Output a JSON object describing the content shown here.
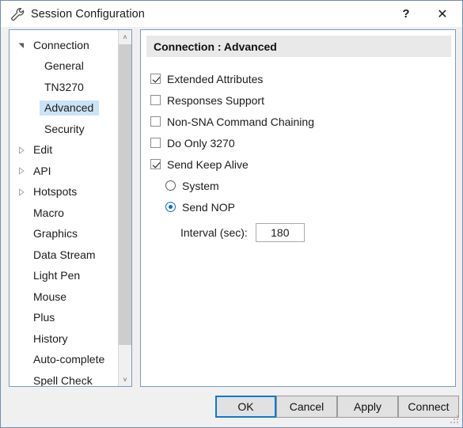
{
  "window": {
    "title": "Session Configuration",
    "icon": "wrench-icon",
    "help_label": "?",
    "close_label": "✕"
  },
  "sidebar": {
    "scrollbar": {
      "up": "˄",
      "down": "˅"
    },
    "items": [
      {
        "label": "Connection",
        "level": 0,
        "state": "expanded",
        "selected": false
      },
      {
        "label": "General",
        "level": 1,
        "state": "leaf",
        "selected": false
      },
      {
        "label": "TN3270",
        "level": 1,
        "state": "leaf",
        "selected": false
      },
      {
        "label": "Advanced",
        "level": 1,
        "state": "leaf",
        "selected": true
      },
      {
        "label": "Security",
        "level": 1,
        "state": "leaf",
        "selected": false
      },
      {
        "label": "Edit",
        "level": 0,
        "state": "collapsed",
        "selected": false
      },
      {
        "label": "API",
        "level": 0,
        "state": "collapsed",
        "selected": false
      },
      {
        "label": "Hotspots",
        "level": 0,
        "state": "collapsed",
        "selected": false
      },
      {
        "label": "Macro",
        "level": 0,
        "state": "leaf",
        "selected": false
      },
      {
        "label": "Graphics",
        "level": 0,
        "state": "leaf",
        "selected": false
      },
      {
        "label": "Data Stream",
        "level": 0,
        "state": "leaf",
        "selected": false
      },
      {
        "label": "Light Pen",
        "level": 0,
        "state": "leaf",
        "selected": false
      },
      {
        "label": "Mouse",
        "level": 0,
        "state": "leaf",
        "selected": false
      },
      {
        "label": "Plus",
        "level": 0,
        "state": "leaf",
        "selected": false
      },
      {
        "label": "History",
        "level": 0,
        "state": "leaf",
        "selected": false
      },
      {
        "label": "Auto-complete",
        "level": 0,
        "state": "leaf",
        "selected": false
      },
      {
        "label": "Spell Check",
        "level": 0,
        "state": "leaf",
        "selected": false
      }
    ]
  },
  "panel": {
    "header": "Connection : Advanced",
    "checkboxes": [
      {
        "label": "Extended Attributes",
        "checked": true
      },
      {
        "label": "Responses Support",
        "checked": false
      },
      {
        "label": "Non-SNA Command Chaining",
        "checked": false
      },
      {
        "label": "Do Only 3270",
        "checked": false
      },
      {
        "label": "Send Keep Alive",
        "checked": true
      }
    ],
    "radios": [
      {
        "label": "System",
        "selected": false
      },
      {
        "label": "Send NOP",
        "selected": true
      }
    ],
    "interval": {
      "label": "Interval (sec):",
      "value": "180"
    }
  },
  "footer": {
    "buttons": [
      {
        "id": "ok",
        "label": "OK",
        "primary": true
      },
      {
        "id": "cancel",
        "label": "Cancel",
        "primary": false
      },
      {
        "id": "apply",
        "label": "Apply",
        "primary": false
      },
      {
        "id": "connect",
        "label": "Connect",
        "primary": false
      }
    ]
  },
  "colors": {
    "accent": "#0b79d0",
    "selection": "#cce3f7",
    "panel_border": "#7a9cc0",
    "dialog_bg": "#f0f0f0",
    "header_bg": "#e9e9e9"
  }
}
